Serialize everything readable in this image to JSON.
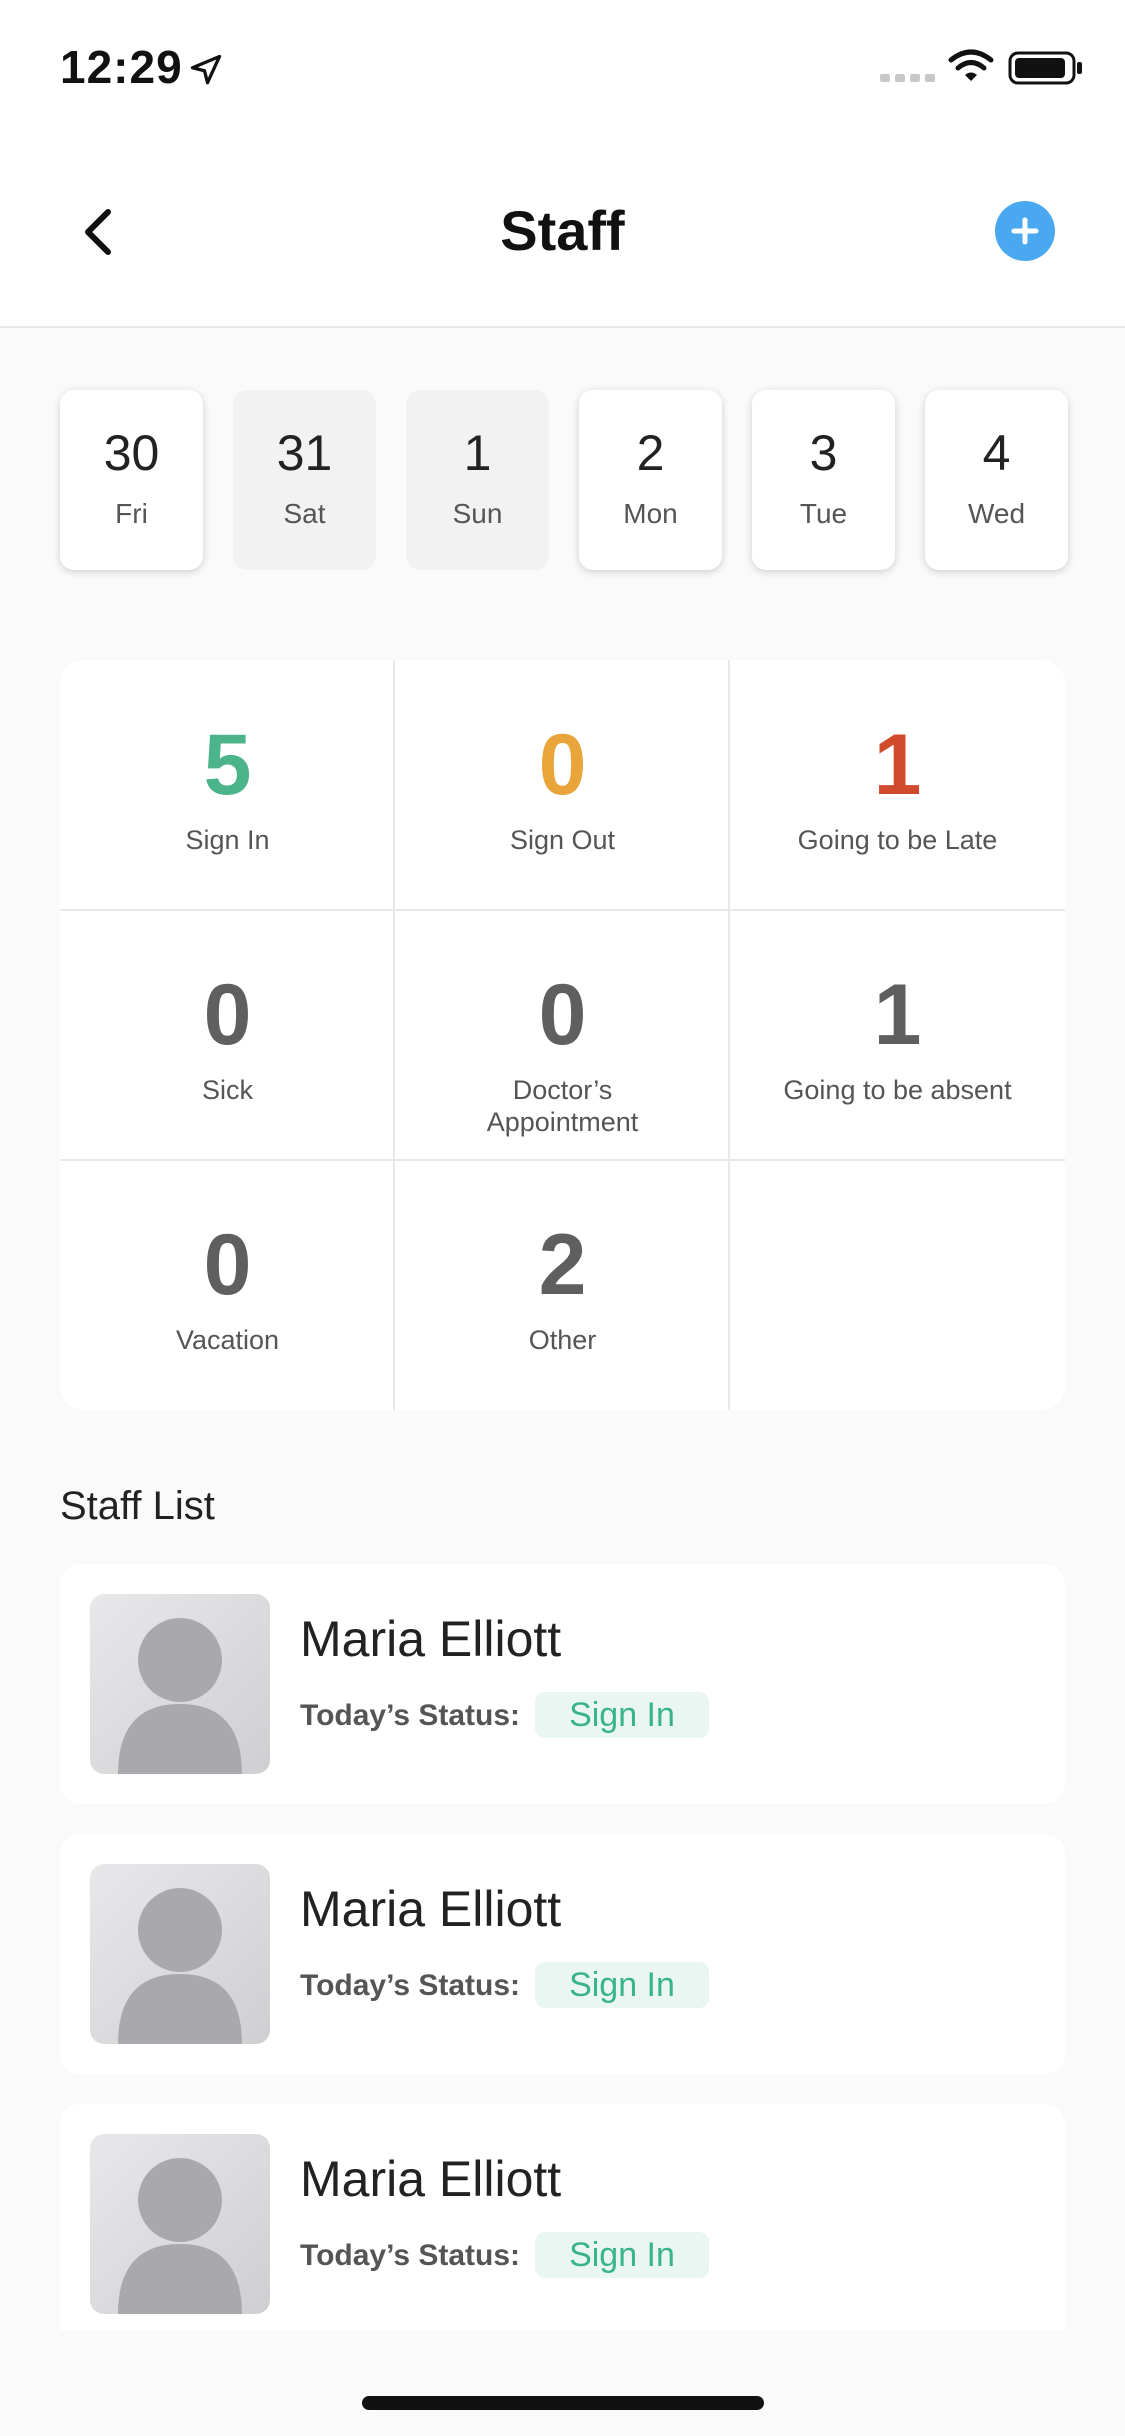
{
  "status_bar": {
    "time": "12:29"
  },
  "nav": {
    "title": "Staff"
  },
  "dates": [
    {
      "num": "30",
      "day": "Fri",
      "style": "light"
    },
    {
      "num": "31",
      "day": "Sat",
      "style": "grey"
    },
    {
      "num": "1",
      "day": "Sun",
      "style": "grey"
    },
    {
      "num": "2",
      "day": "Mon",
      "style": "light"
    },
    {
      "num": "3",
      "day": "Tue",
      "style": "light"
    },
    {
      "num": "4",
      "day": "Wed",
      "style": "light"
    }
  ],
  "stats": [
    {
      "value": "5",
      "label": "Sign In",
      "color": "#4cb48b"
    },
    {
      "value": "0",
      "label": "Sign Out",
      "color": "#e9a43a"
    },
    {
      "value": "1",
      "label": "Going to be Late",
      "color": "#d04a2c"
    },
    {
      "value": "0",
      "label": "Sick",
      "color": "#5f5f5f"
    },
    {
      "value": "0",
      "label": "Doctor’s Appointment",
      "color": "#5f5f5f"
    },
    {
      "value": "1",
      "label": "Going to be absent",
      "color": "#5f5f5f"
    },
    {
      "value": "0",
      "label": "Vacation",
      "color": "#5f5f5f"
    },
    {
      "value": "2",
      "label": "Other",
      "color": "#5f5f5f"
    }
  ],
  "staff_list": {
    "title": "Staff List",
    "items": [
      {
        "name": "Maria Elliott",
        "status_label": "Today’s Status:",
        "status": "Sign In"
      },
      {
        "name": "Maria Elliott",
        "status_label": "Today’s Status:",
        "status": "Sign In"
      },
      {
        "name": "Maria Elliott",
        "status_label": "Today’s Status:",
        "status": "Sign In"
      }
    ]
  },
  "colors": {
    "accent": "#4aa8f0",
    "status_green": "#39b48a",
    "status_green_bg": "#e9f6f1"
  },
  "icons": [
    "location-arrow-icon",
    "signal-icon",
    "wifi-icon",
    "battery-icon",
    "back-chevron-icon",
    "plus-icon",
    "avatar-placeholder-icon"
  ]
}
